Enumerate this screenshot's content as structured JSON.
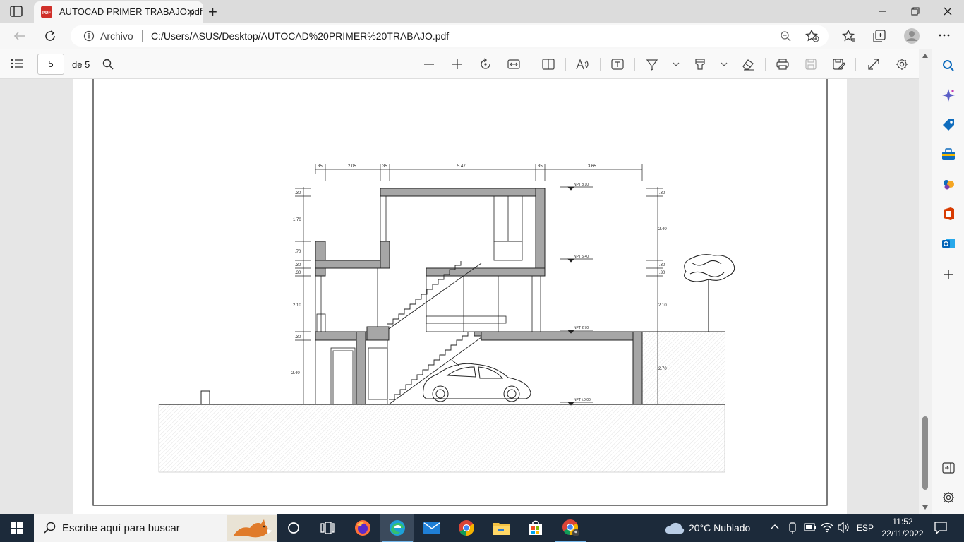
{
  "browser": {
    "tab_title": "AUTOCAD PRIMER TRABAJO.pdf",
    "tab_icon_text": "PDF",
    "new_tab_label": "+",
    "site_info_label": "Archivo",
    "url": "C:/Users/ASUS/Desktop/AUTOCAD%20PRIMER%20TRABAJO.pdf"
  },
  "pdf_toolbar": {
    "current_page": "5",
    "page_count": "de 5"
  },
  "drawing": {
    "top_dimensions": [
      "35",
      "2.05",
      "35",
      "5.47",
      "35",
      "3.65"
    ],
    "left_dimensions": [
      ".30",
      "1.70",
      ".70",
      ".30",
      ".30",
      "2.10",
      ".30",
      "2.40"
    ],
    "right_dimensions": [
      ".30",
      "2.40",
      ".30",
      ".30",
      "2.10",
      "2.70"
    ],
    "levels": [
      "NPT 8.10",
      "NPT 5.40",
      "NPT 2.70",
      "NPT ±0.00"
    ]
  },
  "taskbar": {
    "search_placeholder": "Escribe aquí para buscar",
    "weather": "20°C  Nublado",
    "language": "ESP",
    "time": "11:52",
    "date": "22/11/2022"
  },
  "colors": {
    "accent": "#0078d4",
    "taskbar": "#1c2a3a",
    "wall_fill": "#a6a6a6"
  }
}
